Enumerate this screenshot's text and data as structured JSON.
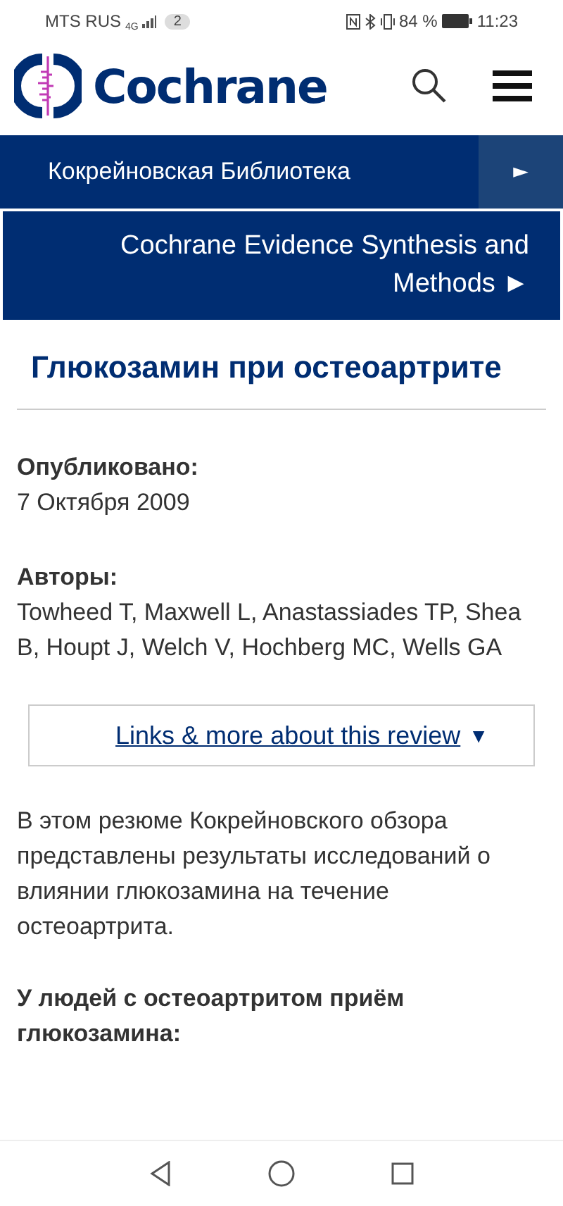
{
  "status_bar": {
    "carrier": "MTS RUS",
    "network": "4G",
    "notification_count": "2",
    "battery": "84 %",
    "time": "11:23"
  },
  "header": {
    "logo_text": "Cochrane"
  },
  "nav": [
    {
      "label": "Кокрейновская Библиотека",
      "arrow": "►"
    },
    {
      "label": "Cochrane Evidence Synthesis and Methods",
      "arrow": "►"
    }
  ],
  "article": {
    "title": "Глюкозамин при остеоартрите",
    "meta": [
      {
        "label": "Опубликовано:",
        "value": "7 Октября 2009"
      },
      {
        "label": "Авторы:",
        "value": "Towheed T, Maxwell L, Anastassiades TP, Shea B, Houpt J, Welch V, Hochberg MC, Wells GA"
      }
    ],
    "links_toggle": {
      "label": "Links & more about this review",
      "caret": "▼"
    },
    "summary": "В этом резюме Кокрейновского обзора представлены результаты исследований о влиянии глюкозамина на течение остеоартрита.",
    "subheading": "У людей с остеоартритом приём глюкозамина:"
  }
}
